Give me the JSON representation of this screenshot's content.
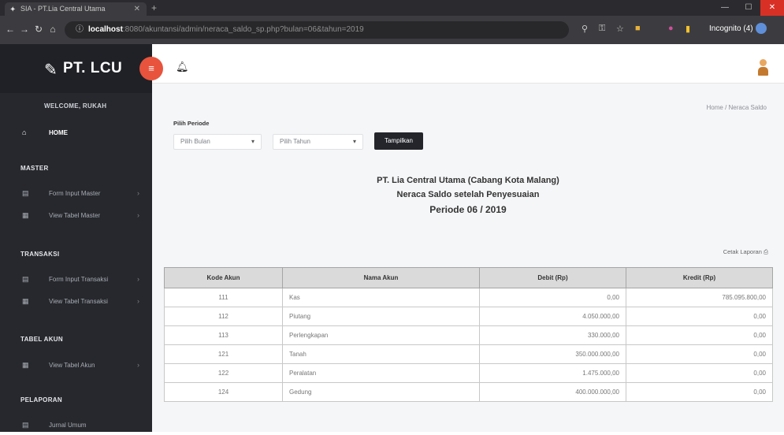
{
  "browser": {
    "tab_title": "SIA - PT.Lia Central Utama",
    "url_host": "localhost",
    "url_path": ":8080/akuntansi/admin/neraca_saldo_sp.php?bulan=06&tahun=2019",
    "profile_label": "Incognito (4)"
  },
  "sidebar": {
    "brand": "PT. LCU",
    "welcome": "WELCOME, RUKAH",
    "home": "HOME",
    "sections": {
      "master": "MASTER",
      "transaksi": "TRANSAKSI",
      "tabel_akun": "TABEL AKUN",
      "pelaporan": "PELAPORAN"
    },
    "items": [
      {
        "label": "Form Input Master"
      },
      {
        "label": "View Tabel Master"
      },
      {
        "label": "Form Input Transaksi"
      },
      {
        "label": "View Tabel Transaksi"
      },
      {
        "label": "View Tabel Akun"
      },
      {
        "label": "Jurnal Umum"
      }
    ]
  },
  "content": {
    "breadcrumb": "Home / Neraca Saldo",
    "form_label": "Pilih Periode",
    "month_select": "Pilih Bulan",
    "year_select": "Pilih Tahun",
    "show_button": "Tampilkan",
    "title_line1": "PT. Lia Central Utama (Cabang Kota Malang)",
    "title_line2": "Neraca Saldo setelah Penyesuaian",
    "title_line3": "Periode 06 / 2019",
    "print_link": "Cetak Laporan"
  },
  "table": {
    "headers": [
      "Kode Akun",
      "Nama Akun",
      "Debit (Rp)",
      "Kredit (Rp)"
    ],
    "rows": [
      [
        "111",
        "Kas",
        "0,00",
        "785.095.800,00"
      ],
      [
        "112",
        "Piutang",
        "4.050.000,00",
        "0,00"
      ],
      [
        "113",
        "Perlengkapan",
        "330.000,00",
        "0,00"
      ],
      [
        "121",
        "Tanah",
        "350.000.000,00",
        "0,00"
      ],
      [
        "122",
        "Peralatan",
        "1.475.000,00",
        "0,00"
      ],
      [
        "124",
        "Gedung",
        "400.000.000,00",
        "0,00"
      ]
    ]
  },
  "colors": {
    "sidebar_bg": "#26282e",
    "toggle_accent": "#e8533d",
    "button_dark": "#23252b",
    "table_header": "#dadada"
  }
}
